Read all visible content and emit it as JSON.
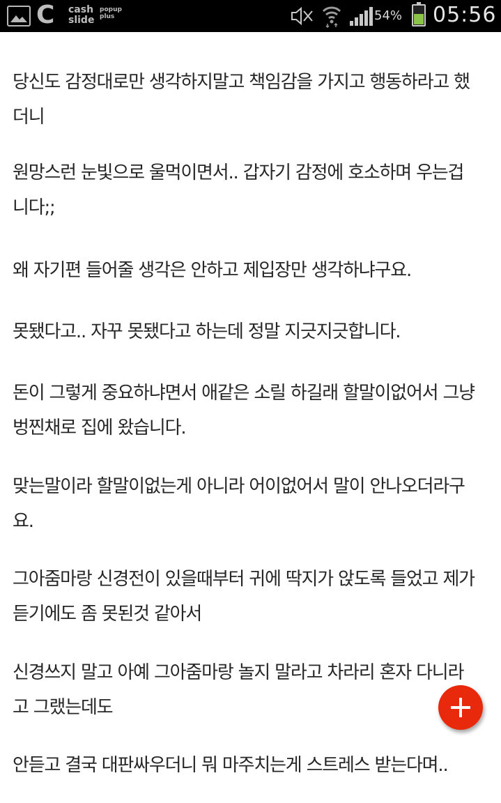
{
  "status_bar": {
    "notification_icons": [
      "gallery-icon",
      "c-app-icon"
    ],
    "cash_slide_label": "cash\nslide",
    "popup_plus_label": "popup\nplus",
    "battery_percent": "54%",
    "battery_level": 0.54,
    "time": "05:56",
    "colors": {
      "background": "#000000",
      "battery_fill": "#8bc34a"
    }
  },
  "article": {
    "paragraphs": [
      "당신도 감정대로만 생각하지말고 책임감을 가지고 행동하라고 했\n더니",
      "원망스런 눈빛으로 울먹이면서.. 갑자기 감정에 호소하며 우는겁\n니다;;",
      "왜 자기편 들어줄 생각은 안하고 제입장만 생각하냐구요.",
      "못됐다고.. 자꾸 못됐다고 하는데 정말 지긋지긋합니다.",
      "돈이 그렇게 중요하냐면서 애같은 소릴 하길래 할말이없어서 그냥\n벙찐채로 집에 왔습니다.",
      "맞는말이라 할말이없는게 아니라 어이없어서 말이 안나오더라구\n요.",
      "그아줌마랑 신경전이 있을때부터 귀에 딱지가 앉도록 들었고 제가\n듣기에도 좀 못된것 같아서",
      "신경쓰지 말고 아예 그아줌마랑 놀지 말라고 차라리 혼자 다니라\n고 그랬는데도",
      "안듣고 결국 대판싸우더니 뭐 마주치는게 스트레스 받는다며.."
    ],
    "text_color": "#262626"
  },
  "fab": {
    "icon": "plus-icon",
    "color": "#e8290b"
  }
}
